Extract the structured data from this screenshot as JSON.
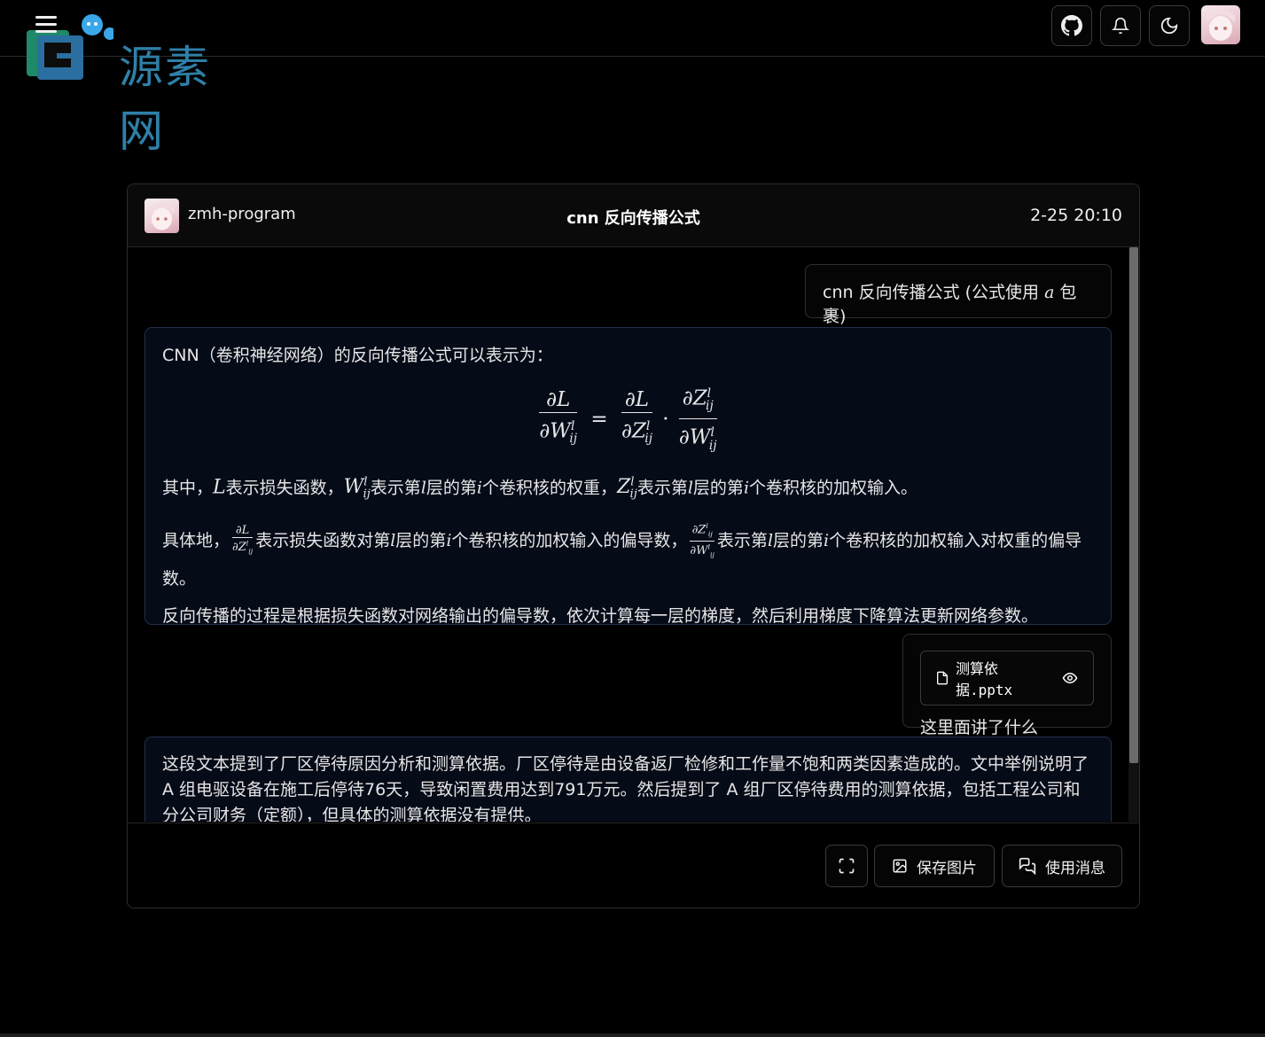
{
  "logo": {
    "text": "源素网"
  },
  "chat": {
    "user_name": "zmh-program",
    "title": "cnn 反向传播公式",
    "time": "2-25 20:10",
    "messages": {
      "q1_prefix": "cnn 反向传播公式 (公式使用 ",
      "q1_math": "a",
      "q1_suffix": " 包裹)",
      "a1_intro": "CNN（卷积神经网络）的反向传播公式可以表示为：",
      "a1_p2": {
        "t1": "其中，",
        "t2": "表示损失函数，",
        "t3": "表示第",
        "t4": "层的第",
        "t5": "个卷积核的权重，",
        "t6": "表示第",
        "t7": "层的第",
        "t8": "个卷积核的加权输入。"
      },
      "a1_p3": {
        "t1": "具体地，",
        "t2": "表示损失函数对第",
        "t3": "层的第",
        "t4": "个卷积核的加权输入的偏导数，",
        "t5": "表示第",
        "t6": "层的第",
        "t7": "个卷积核的加权输入对权重的偏导数。"
      },
      "a1_p4": "反向传播的过程是根据损失函数对网络输出的偏导数，依次计算每一层的梯度，然后利用梯度下降算法更新网络参数。",
      "file_name": "测算依据.pptx",
      "q2": "这里面讲了什么",
      "a2": "这段文本提到了厂区停待原因分析和测算依据。厂区停待是由设备返厂检修和工作量不饱和两类因素造成的。文中举例说明了 A 组电驱设备在施工后停待76天，导致闲置费用达到791万元。然后提到了 A 组厂区停待费用的测算依据，包括工程公司和分公司财务（定额），但具体的测算依据没有提供。"
    }
  },
  "footer": {
    "save_image_label": "保存图片",
    "use_message_label": "使用消息"
  },
  "icons": {
    "menu": "menu-icon",
    "github": "github-icon",
    "bell": "bell-icon",
    "moon": "moon-icon",
    "file": "file-icon",
    "eye": "eye-icon",
    "fullscreen": "fullscreen-icon",
    "image": "image-icon",
    "chat": "chat-icon"
  },
  "colors": {
    "background": "#000000",
    "ai_bubble": "#060b18",
    "logo": "#2f80a8"
  }
}
